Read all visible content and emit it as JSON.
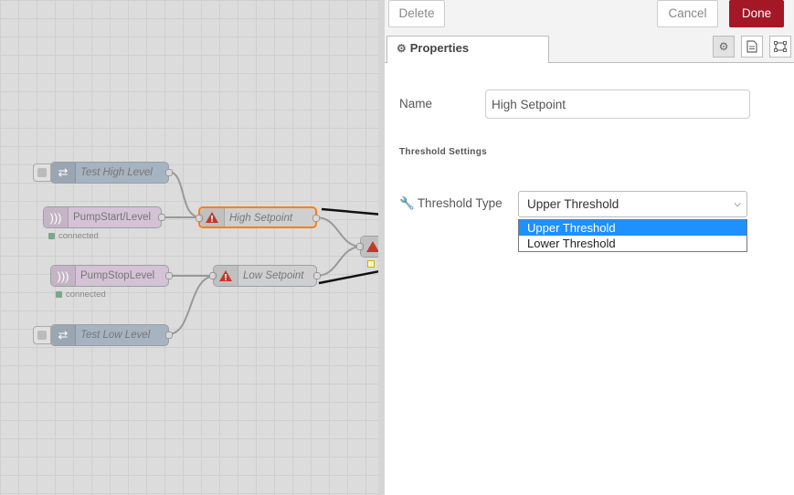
{
  "canvas": {
    "nodes": [
      {
        "label": "Test High Level",
        "kind": "inject",
        "italic": true
      },
      {
        "label": "PumpStart/Level",
        "kind": "mqtt",
        "italic": false,
        "status": "connected"
      },
      {
        "label": "High Setpoint",
        "kind": "threshold",
        "italic": true,
        "selected": true
      },
      {
        "label": "PumpStopLevel",
        "kind": "mqtt",
        "italic": false,
        "status": "connected"
      },
      {
        "label": "Low Setpoint",
        "kind": "threshold",
        "italic": true
      },
      {
        "label": "Test Low Level",
        "kind": "inject",
        "italic": true
      }
    ]
  },
  "toolbar": {
    "delete_label": "Delete",
    "cancel_label": "Cancel",
    "done_label": "Done"
  },
  "tabs": {
    "properties_label": "Properties",
    "icons": [
      "gear-icon",
      "description-icon",
      "appearance-icon"
    ]
  },
  "form": {
    "name_label": "Name",
    "name_value": "High Setpoint",
    "section_title": "Threshold Settings",
    "threshold_type_label": "Threshold Type",
    "threshold_type_value": "Upper Threshold",
    "threshold_options": [
      {
        "label": "Upper Threshold",
        "highlighted": true
      },
      {
        "label": "Lower Threshold",
        "highlighted": false
      }
    ]
  },
  "colors": {
    "done": "#a31727",
    "highlight": "#1e90ff",
    "inject_node": "#a6b3c0",
    "mqtt_node": "#d4c2d6",
    "threshold_node": "#cfcfcf",
    "selected_outline": "#ff7f0e"
  }
}
